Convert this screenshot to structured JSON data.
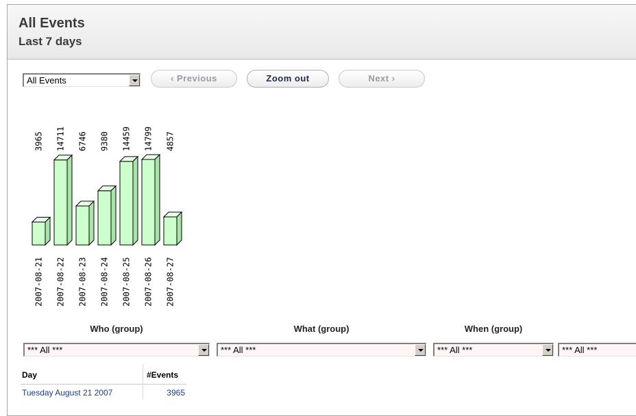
{
  "header": {
    "title": "All Events",
    "subtitle": "Last 7 days"
  },
  "toolbar": {
    "event_select_value": "All Events",
    "previous_label": "‹ Previous",
    "zoom_out_label": "Zoom out",
    "next_label": "Next ›"
  },
  "chart_data": {
    "type": "bar",
    "categories": [
      "2007-08-21",
      "2007-08-22",
      "2007-08-23",
      "2007-08-24",
      "2007-08-25",
      "2007-08-26",
      "2007-08-27"
    ],
    "values": [
      3965,
      14711,
      6746,
      9380,
      14459,
      14799,
      4857
    ],
    "bar_color": "#ccffcc",
    "style": "3d"
  },
  "filters": [
    {
      "label": "Who (group)",
      "value": "*** All ***"
    },
    {
      "label": "What (group)",
      "value": "*** All ***"
    },
    {
      "label": "When (group)",
      "value": "*** All ***"
    },
    {
      "label": "",
      "value": "*** All ***"
    }
  ],
  "table": {
    "columns": [
      "Day",
      "#Events"
    ],
    "rows": [
      {
        "day": "Tuesday August 21 2007",
        "events": "3965"
      }
    ]
  }
}
